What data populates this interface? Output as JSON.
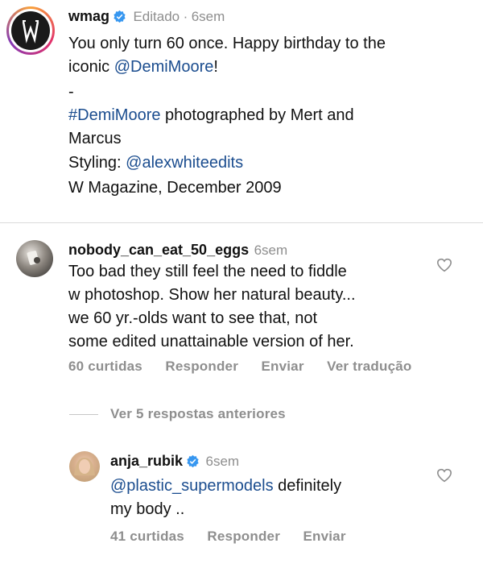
{
  "post": {
    "username": "wmag",
    "edited": "Editado",
    "time": "6sem",
    "caption_line1_text": "You only turn 60 once. Happy birthday to the",
    "caption_line2_prefix": "iconic ",
    "caption_mention": "@DemiMoore",
    "caption_line2_suffix": "!",
    "dash": "-",
    "hashtag": "#DemiMoore",
    "photo_credit_1": " photographed by Mert and",
    "photo_credit_2": "Marcus",
    "styling_label": "Styling: ",
    "styling_mention": "@alexwhiteedits",
    "issue": "W Magazine, December 2009"
  },
  "comment1": {
    "username": "nobody_can_eat_50_eggs",
    "time": "6sem",
    "lines": [
      "Too bad they still feel the need to fiddle",
      "w photoshop. Show her natural beauty...",
      "we 60 yr.-olds want to see that, not",
      "some edited unattainable version of her."
    ],
    "likes": "60 curtidas",
    "reply": "Responder",
    "send": "Enviar",
    "translate": "Ver tradução"
  },
  "view_replies": "Ver 5 respostas anteriores",
  "reply1": {
    "username": "anja_rubik",
    "time": "6sem",
    "mention": "@plastic_supermodels",
    "line1_suffix": " definitely",
    "line2": "my body ..",
    "likes": "41 curtidas",
    "reply": "Responder",
    "send": "Enviar"
  },
  "colors": {
    "link": "#1b4d8f",
    "verified": "#3797f0",
    "meta": "#8e8e8e"
  }
}
